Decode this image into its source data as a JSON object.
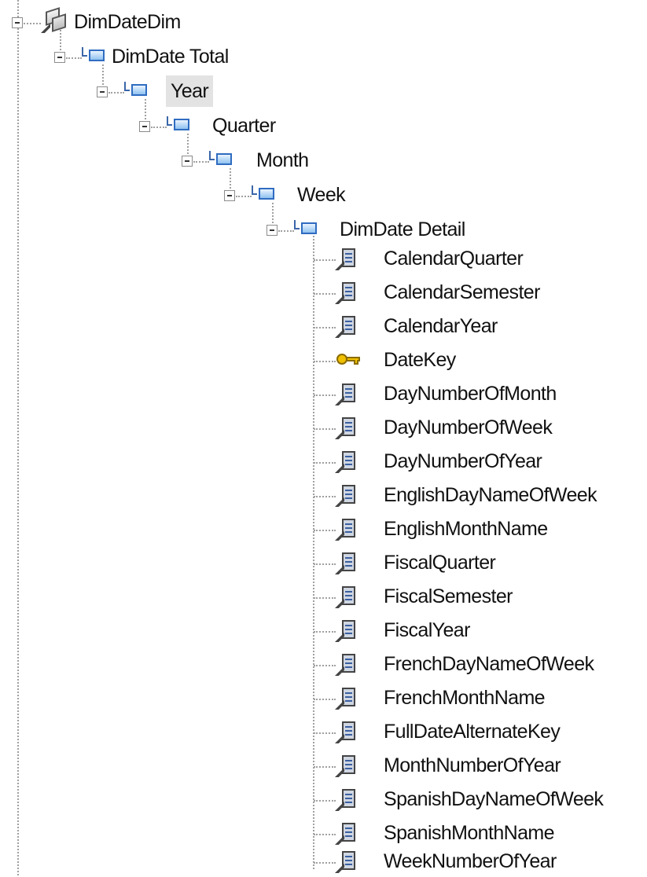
{
  "tree": {
    "root": {
      "label": "DimDateDim",
      "icon": "dimension-icon"
    },
    "levels": [
      {
        "label": "DimDate Total",
        "icon": "level-icon"
      },
      {
        "label": "Year",
        "icon": "level-icon",
        "selected": true
      },
      {
        "label": "Quarter",
        "icon": "level-icon"
      },
      {
        "label": "Month",
        "icon": "level-icon"
      },
      {
        "label": "Week",
        "icon": "level-icon"
      },
      {
        "label": "DimDate Detail",
        "icon": "level-icon"
      }
    ],
    "attributes": [
      {
        "label": "CalendarQuarter",
        "icon": "attribute-icon"
      },
      {
        "label": "CalendarSemester",
        "icon": "attribute-icon"
      },
      {
        "label": "CalendarYear",
        "icon": "attribute-icon"
      },
      {
        "label": "DateKey",
        "icon": "key-icon"
      },
      {
        "label": "DayNumberOfMonth",
        "icon": "attribute-icon"
      },
      {
        "label": "DayNumberOfWeek",
        "icon": "attribute-icon"
      },
      {
        "label": "DayNumberOfYear",
        "icon": "attribute-icon"
      },
      {
        "label": "EnglishDayNameOfWeek",
        "icon": "attribute-icon"
      },
      {
        "label": "EnglishMonthName",
        "icon": "attribute-icon"
      },
      {
        "label": "FiscalQuarter",
        "icon": "attribute-icon"
      },
      {
        "label": "FiscalSemester",
        "icon": "attribute-icon"
      },
      {
        "label": "FiscalYear",
        "icon": "attribute-icon"
      },
      {
        "label": "FrenchDayNameOfWeek",
        "icon": "attribute-icon"
      },
      {
        "label": "FrenchMonthName",
        "icon": "attribute-icon"
      },
      {
        "label": "FullDateAlternateKey",
        "icon": "attribute-icon"
      },
      {
        "label": "MonthNumberOfYear",
        "icon": "attribute-icon"
      },
      {
        "label": "SpanishDayNameOfWeek",
        "icon": "attribute-icon"
      },
      {
        "label": "SpanishMonthName",
        "icon": "attribute-icon"
      },
      {
        "label": "WeekNumberOfYear",
        "icon": "attribute-icon"
      }
    ]
  }
}
